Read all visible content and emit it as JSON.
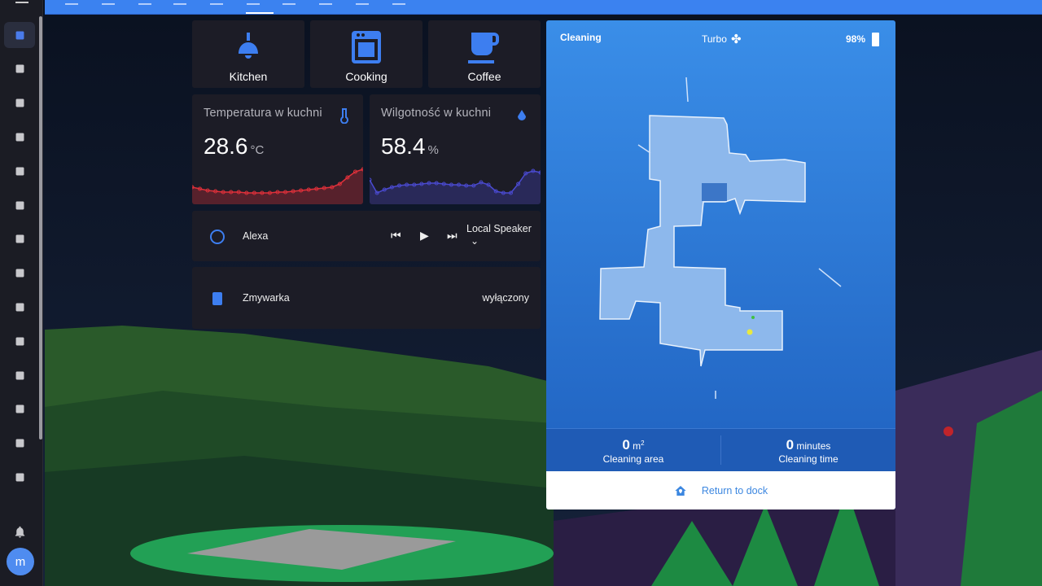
{
  "sidebar": {
    "items": [
      "dashboard",
      "map",
      "logbook",
      "history",
      "hacs",
      "database",
      "calendar",
      "mqtt",
      "terminal",
      "esphome",
      "radar",
      "backup",
      "media",
      "media-player"
    ],
    "notifications_icon": "bell-icon",
    "user_initial": "m"
  },
  "buttons": [
    {
      "label": "Kitchen",
      "icon": "ceiling-light-icon"
    },
    {
      "label": "Cooking",
      "icon": "stove-icon"
    },
    {
      "label": "Coffee",
      "icon": "coffee-icon"
    }
  ],
  "sensors": [
    {
      "name": "Temperatura w kuchni",
      "value": "28.6",
      "unit": "°C",
      "icon": "thermometer-icon",
      "color": "#e0303a",
      "history": [
        21,
        19,
        17,
        16,
        15,
        15,
        15,
        14,
        14,
        14,
        14,
        15,
        15,
        16,
        17,
        18,
        19,
        20,
        21,
        25,
        33,
        40,
        43
      ]
    },
    {
      "name": "Wilgotność w kuchni",
      "value": "58.4",
      "unit": "%",
      "icon": "water-percent-icon",
      "color": "#4a4ad0",
      "history": [
        30,
        14,
        18,
        21,
        23,
        24,
        24,
        25,
        26,
        26,
        25,
        24,
        24,
        23,
        23,
        27,
        24,
        16,
        14,
        14,
        25,
        38,
        41,
        39
      ]
    }
  ],
  "media": {
    "name": "Alexa",
    "source": "Local Speaker",
    "icon": "amazon-alexa-icon"
  },
  "dishwasher": {
    "name": "Zmywarka",
    "state": "wyłączony",
    "icon": "dishwasher-icon"
  },
  "vacuum": {
    "status": "Cleaning",
    "fan_speed": "Turbo",
    "battery": "98%",
    "area_value": "0",
    "area_unit": "m",
    "area_label": "Cleaning area",
    "time_value": "0",
    "time_unit": "minutes",
    "time_label": "Cleaning time",
    "dock_label": "Return to dock",
    "bg_color": "#3a8ee8"
  }
}
